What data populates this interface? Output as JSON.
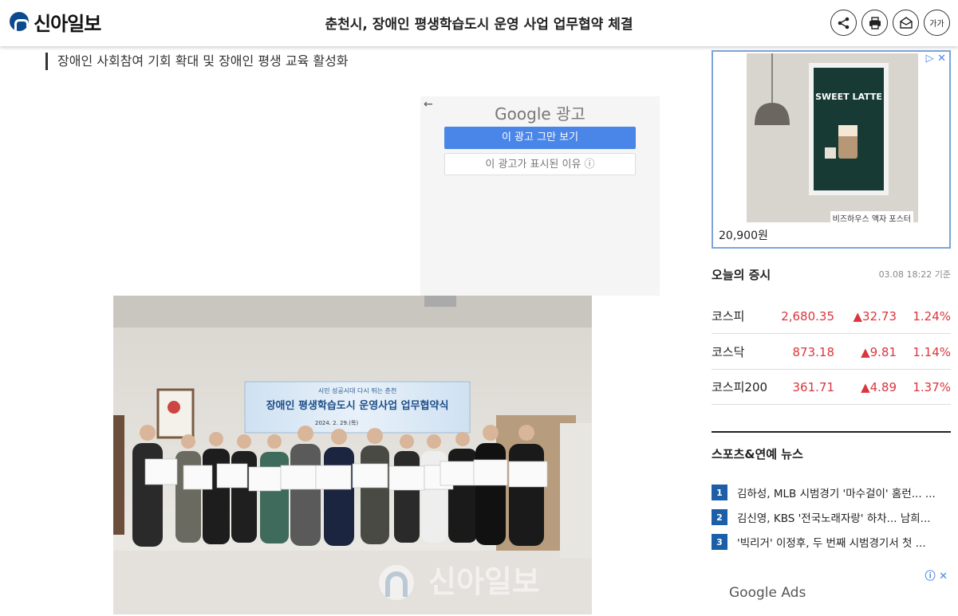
{
  "header": {
    "logo_text": "신아일보",
    "title": "춘천시, 장애인 평생학습도시 운영 사업 업무협약 체결",
    "buttons": [
      {
        "name": "share-icon",
        "glyph": "share"
      },
      {
        "name": "print-icon",
        "glyph": "print"
      },
      {
        "name": "email-icon",
        "glyph": "email"
      },
      {
        "name": "font-size-icon",
        "glyph": "가가"
      }
    ]
  },
  "article": {
    "subtitle": "장애인 사회참여 기회 확대 및 장애인 평생 교육 활성화",
    "photo": {
      "banner_top": "시민 성공시대 다시 뛰는 춘천",
      "banner_title": "장애인 평생학습도시 운영사업 업무협약식",
      "banner_date": "2024. 2. 29.(목)",
      "watermark": "신아일보"
    }
  },
  "google_ad": {
    "back_glyph": "←",
    "logo": "Google 광고",
    "stop_label": "이 광고 그만 보기",
    "why_label": "이 광고가 표시된 이유 ⓘ"
  },
  "sidebar_ad": {
    "poster_title": "SWEET LATTE",
    "product_name": "비즈하우스 액자 포스터",
    "price": "20,900원",
    "adchoices": "▷ ✕"
  },
  "stocks": {
    "title": "오늘의 증시",
    "timestamp": "03.08 18:22 기준",
    "rows": [
      {
        "name": "코스피",
        "value": "2,680.35",
        "change": "▲32.73",
        "pct": "1.24%"
      },
      {
        "name": "코스닥",
        "value": "873.18",
        "change": "▲9.81",
        "pct": "1.14%"
      },
      {
        "name": "코스피200",
        "value": "361.71",
        "change": "▲4.89",
        "pct": "1.37%"
      }
    ]
  },
  "news": {
    "title": "스포츠&연예 뉴스",
    "items": [
      {
        "num": "1",
        "text": "김하성, MLB 시범경기 '마수걸이' 홈런... ..."
      },
      {
        "num": "2",
        "text": "김신영, KBS '전국노래자랑' 하차... 남희..."
      },
      {
        "num": "3",
        "text": "'빅리거' 이정후, 두 번째 시범경기서 첫 ..."
      }
    ]
  },
  "bottom_ad": {
    "logo": "Google Ads",
    "adchoices": "ⓘ ✕"
  },
  "colors": {
    "brand_blue": "#0b4a8e",
    "rise_red": "#d9363e",
    "news_badge": "#1c5fa8",
    "ad_button": "#4a86e8"
  }
}
